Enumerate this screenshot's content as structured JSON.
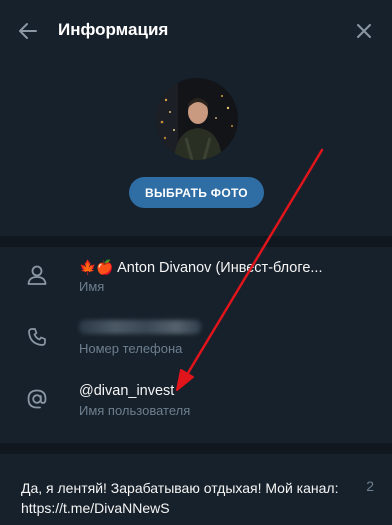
{
  "header": {
    "title": "Информация",
    "back_icon": "arrow-left-icon",
    "close_icon": "close-icon"
  },
  "profile": {
    "photo_button_label": "ВЫБРАТЬ ФОТО",
    "name_emoji": "🍁🍎",
    "name_value": "Anton Divanov (Инвест-блоге...",
    "name_label": "Имя",
    "phone_label": "Номер телефона",
    "username_value": "@divan_invest",
    "username_label": "Имя пользователя"
  },
  "bio": {
    "text": "Да, я лентяй! Зарабатываю отдыхая! Мой канал: https://t.me/DivaNNewS",
    "remaining": "2"
  },
  "colors": {
    "background": "#17212b",
    "separator": "#10171f",
    "accent_button": "#2f6ea5",
    "secondary_text": "#6d7f8f",
    "annotation_arrow": "#e0141b"
  }
}
